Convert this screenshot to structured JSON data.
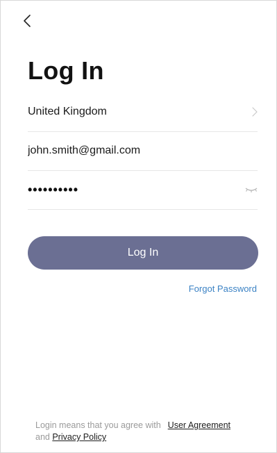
{
  "header": {
    "back_icon": "chevron-left-icon",
    "title": "Log In"
  },
  "form": {
    "country": {
      "value": "United Kingdom",
      "icon": "chevron-right-icon"
    },
    "email": {
      "value": "john.smith@gmail.com"
    },
    "password": {
      "masked": "••••••••••",
      "icon": "eye-closed-icon"
    }
  },
  "actions": {
    "login_label": "Log In",
    "forgot_label": "Forgot Password"
  },
  "footer": {
    "prefix": "Login means that you agree with",
    "user_agreement": "User Agreement",
    "and": "and",
    "privacy_policy": "Privacy Policy"
  },
  "colors": {
    "button": "#6b6f93",
    "link_blue": "#3b82c4",
    "divider": "#e6e6e6"
  }
}
